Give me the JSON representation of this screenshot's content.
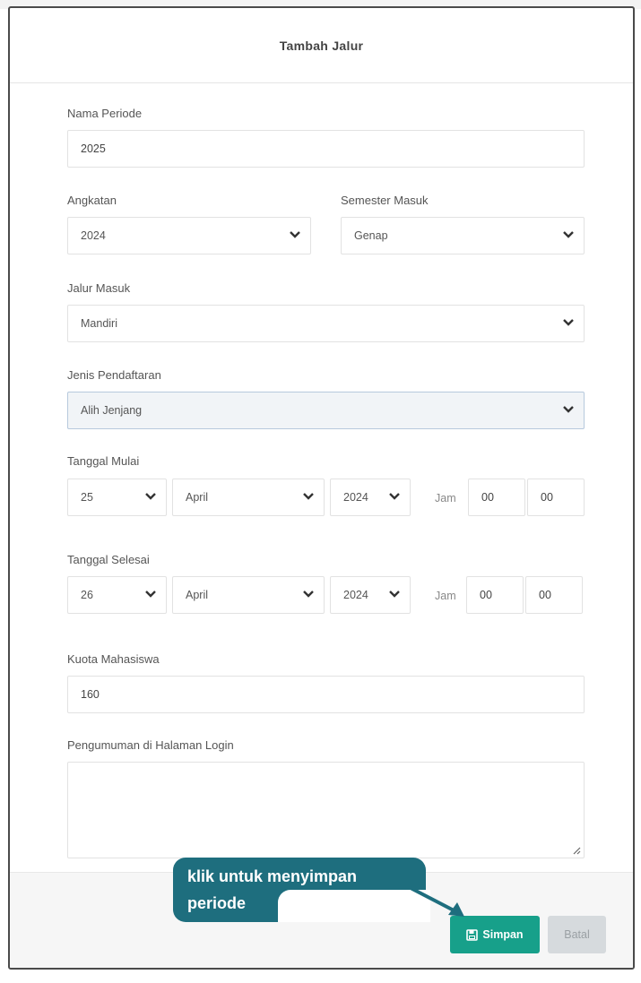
{
  "modal": {
    "title": "Tambah Jalur"
  },
  "form": {
    "nama_periode": {
      "label": "Nama Periode",
      "value": "2025"
    },
    "angkatan": {
      "label": "Angkatan",
      "value": "2024"
    },
    "semester_masuk": {
      "label": "Semester Masuk",
      "value": "Genap"
    },
    "jalur_masuk": {
      "label": "Jalur Masuk",
      "value": "Mandiri"
    },
    "jenis_pendaftaran": {
      "label": "Jenis Pendaftaran",
      "value": "Alih Jenjang"
    },
    "tanggal_mulai": {
      "label": "Tanggal Mulai",
      "day": "25",
      "month": "April",
      "year": "2024",
      "jam_label": "Jam",
      "hour": "00",
      "minute": "00"
    },
    "tanggal_selesai": {
      "label": "Tanggal Selesai",
      "day": "26",
      "month": "April",
      "year": "2024",
      "jam_label": "Jam",
      "hour": "00",
      "minute": "00"
    },
    "kuota": {
      "label": "Kuota Mahasiswa",
      "value": "160"
    },
    "pengumuman": {
      "label": "Pengumuman di Halaman Login",
      "value": ""
    }
  },
  "footer": {
    "simpan_label": "Simpan",
    "batal_label": "Batal"
  },
  "callout": {
    "line1": "klik untuk menyimpan",
    "line2": "periode"
  },
  "colors": {
    "primary": "#17a08a",
    "callout": "#1e6e7e",
    "secondary": "#d6dadd"
  }
}
